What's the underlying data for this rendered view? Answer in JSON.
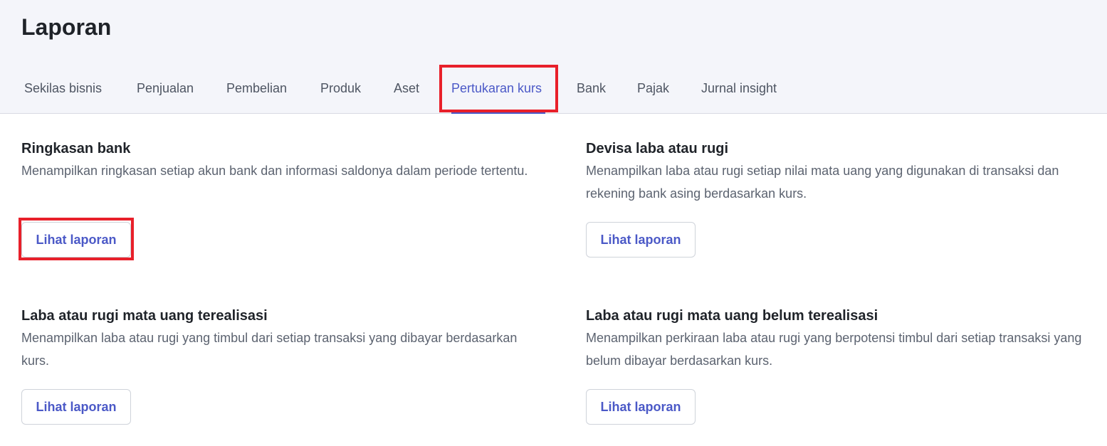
{
  "header": {
    "title": "Laporan"
  },
  "tabs": [
    {
      "label": "Sekilas bisnis",
      "active": false
    },
    {
      "label": "Penjualan",
      "active": false
    },
    {
      "label": "Pembelian",
      "active": false
    },
    {
      "label": "Produk",
      "active": false
    },
    {
      "label": "Aset",
      "active": false
    },
    {
      "label": "Pertukaran kurs",
      "active": true
    },
    {
      "label": "Bank",
      "active": false
    },
    {
      "label": "Pajak",
      "active": false
    },
    {
      "label": "Jurnal insight",
      "active": false
    }
  ],
  "cards": [
    {
      "title": "Ringkasan bank",
      "description": "Menampilkan ringkasan setiap akun bank dan informasi saldonya dalam periode tertentu.",
      "button_label": "Lihat laporan"
    },
    {
      "title": "Devisa laba atau rugi",
      "description": "Menampilkan laba atau rugi setiap nilai mata uang yang digunakan di transaksi dan rekening bank asing berdasarkan kurs.",
      "button_label": "Lihat laporan"
    },
    {
      "title": "Laba atau rugi mata uang terealisasi",
      "description": "Menampilkan laba atau rugi yang timbul dari setiap transaksi yang dibayar berdasarkan kurs.",
      "button_label": "Lihat laporan"
    },
    {
      "title": "Laba atau rugi mata uang belum terealisasi",
      "description": "Menampilkan perkiraan laba atau rugi yang berpotensi timbul dari setiap transaksi yang belum dibayar berdasarkan kurs.",
      "button_label": "Lihat laporan"
    }
  ],
  "colors": {
    "accent": "#4b59c7",
    "highlight": "#e8202a",
    "header_bg": "#f4f5fa"
  }
}
